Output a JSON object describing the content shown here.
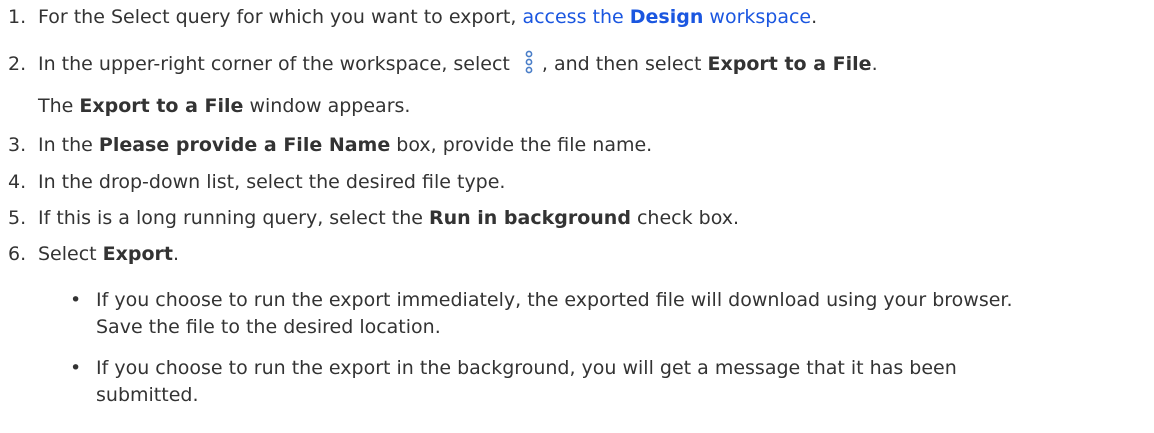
{
  "steps": [
    {
      "num": "1.",
      "pre": "For the Select query for which you want to export, ",
      "link_pre": "access the ",
      "link_bold": "Design",
      "link_post": " workspace",
      "post": "."
    },
    {
      "num": "2.",
      "pre": "In the upper-right corner of the workspace, select ",
      "icon": "more-options-kebab-icon",
      "mid": ", and then select ",
      "bold": "Export to a File",
      "post": "."
    },
    {
      "pre": "",
      "bold": "Export to a File",
      "post": " window appears.",
      "lead": "The "
    },
    {
      "num": "3.",
      "pre": "In the ",
      "bold": "Please provide a File Name",
      "post": " box, provide the file name."
    },
    {
      "num": "4.",
      "text": "In the drop-down list, select the desired file type."
    },
    {
      "num": "5.",
      "pre": "If this is a long running query, select the ",
      "bold": "Run in background",
      "post": " check box."
    },
    {
      "num": "6.",
      "pre": "Select ",
      "bold": "Export",
      "post": "."
    }
  ],
  "bullets": [
    {
      "line1": "If you choose to run the export immediately, the exported file will download using your browser.",
      "line2": "Save the file to the desired location."
    },
    {
      "line1": "If you choose to run the export in the background, you will get a message that it has been",
      "line2": "submitted."
    }
  ],
  "bullet_symbol": "•",
  "colors": {
    "text": "#333333",
    "link": "#1a56e0",
    "icon": "#4a7ec8"
  }
}
